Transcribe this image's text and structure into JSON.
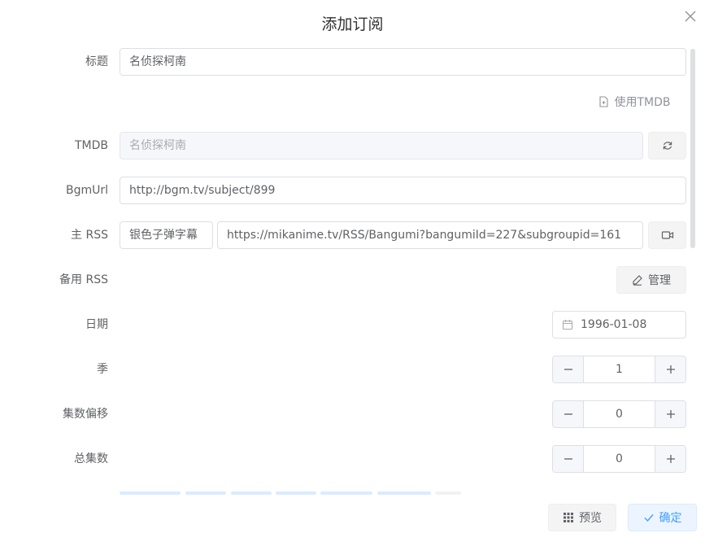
{
  "dialog": {
    "title": "添加订阅"
  },
  "form": {
    "title_label": "标题",
    "title_value": "名侦探柯南",
    "use_tmdb_label": "使用TMDB",
    "tmdb_label": "TMDB",
    "tmdb_value": "名侦探柯南",
    "bgmurl_label": "BgmUrl",
    "bgmurl_value": "http://bgm.tv/subject/899",
    "main_rss_label": "主 RSS",
    "main_rss_group": "银色子弹字幕",
    "main_rss_url": "https://mikanime.tv/RSS/Bangumi?bangumiId=227&subgroupid=161",
    "backup_rss_label": "备用 RSS",
    "manage_label": "管理",
    "date_label": "日期",
    "date_value": "1996-01-08",
    "season_label": "季",
    "season_value": "1",
    "offset_label": "集数偏移",
    "offset_value": "0",
    "total_label": "总集数",
    "total_value": "0"
  },
  "footer": {
    "preview_label": "预览",
    "confirm_label": "确定"
  },
  "colors": {
    "primary": "#409eff",
    "text": "#606266",
    "border": "#dcdfe6"
  }
}
